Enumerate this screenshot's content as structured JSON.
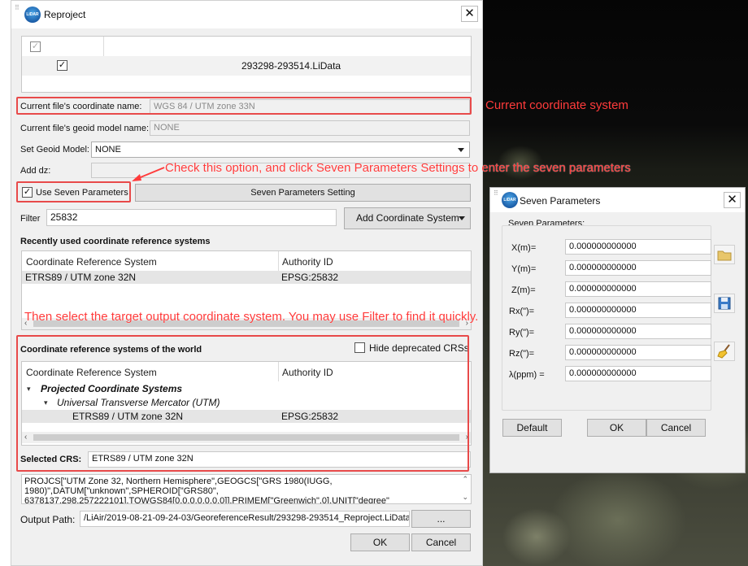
{
  "dialog": {
    "title": "Reproject",
    "close": "✕",
    "file_row": "293298-293514.LiData",
    "labels": {
      "coord_name": "Current file's coordinate name:",
      "geoid_name": "Current file's geoid model name:",
      "set_geoid": "Set Geoid Model:",
      "add_dz": "Add dz:",
      "use_seven": "Use Seven Parameters",
      "filter": "Filter",
      "recent_header": "Recently used coordinate reference systems",
      "world_header": "Coordinate reference systems of the world",
      "hide_deprecated": "Hide deprecated CRSs",
      "selected_crs": "Selected CRS:",
      "output_path": "Output Path:"
    },
    "values": {
      "coord_name": "WGS 84 / UTM zone 33N",
      "geoid_name": "NONE",
      "set_geoid": "NONE",
      "add_dz": "",
      "filter": "25832",
      "selected_crs": "ETRS89 / UTM zone 32N",
      "output_path": "/LiAir/2019-08-21-09-24-03/GeoreferenceResult/293298-293514_Reproject.LiData",
      "wkt": "PROJCS[\"UTM Zone 32, Northern Hemisphere\",GEOGCS[\"GRS 1980(IUGG, 1980)\",DATUM[\"unknown\",SPHEROID[\"GRS80\", 6378137,298.257222101],TOWGS84[0,0,0,0,0,0,0]],PRIMEM[\"Greenwich\",0],UNIT[\"degree\""
    },
    "buttons": {
      "seven_setting": "Seven Parameters Setting",
      "add_crs": "Add Coordinate System",
      "browse": "...",
      "ok": "OK",
      "cancel": "Cancel"
    },
    "table_headers": {
      "crs": "Coordinate Reference System",
      "authority": "Authority ID"
    },
    "recent": [
      {
        "crs": "ETRS89 / UTM zone 32N",
        "authority": "EPSG:25832"
      }
    ],
    "world_tree": {
      "projected": "Projected Coordinate Systems",
      "utm": "Universal Transverse Mercator (UTM)",
      "item": {
        "crs": "ETRS89 / UTM zone 32N",
        "authority": "EPSG:25832"
      }
    }
  },
  "annotations": {
    "current_cs": "Current coordinate system",
    "check_option": "Check this option, and click Seven Parameters Settings to enter the seven parameters",
    "select_target": "Then select the target output coordinate system. You may use Filter to find it quickly."
  },
  "seven": {
    "title": "Seven Parameters",
    "close": "✕",
    "group": "Seven Parameters:",
    "params": [
      {
        "label": "X(m)=",
        "value": "0.000000000000"
      },
      {
        "label": "Y(m)=",
        "value": "0.000000000000"
      },
      {
        "label": "Z(m)=",
        "value": "0.000000000000"
      },
      {
        "label": "Rx(\")=",
        "value": "0.000000000000"
      },
      {
        "label": "Ry(\")=",
        "value": "0.000000000000"
      },
      {
        "label": "Rz(\")=",
        "value": "0.000000000000"
      },
      {
        "label": "λ(ppm) =",
        "value": "0.000000000000"
      }
    ],
    "buttons": {
      "default": "Default",
      "ok": "OK",
      "cancel": "Cancel"
    }
  },
  "colors": {
    "annotation_red": "#e84a4a",
    "dialog_bg": "#f0f0f0",
    "selected_row": "#e5e5e5"
  },
  "icons": [
    "liair-logo-icon",
    "close-icon",
    "checkbox-icon",
    "chevron-down-icon",
    "folder-open-icon",
    "save-icon",
    "broom-icon"
  ]
}
